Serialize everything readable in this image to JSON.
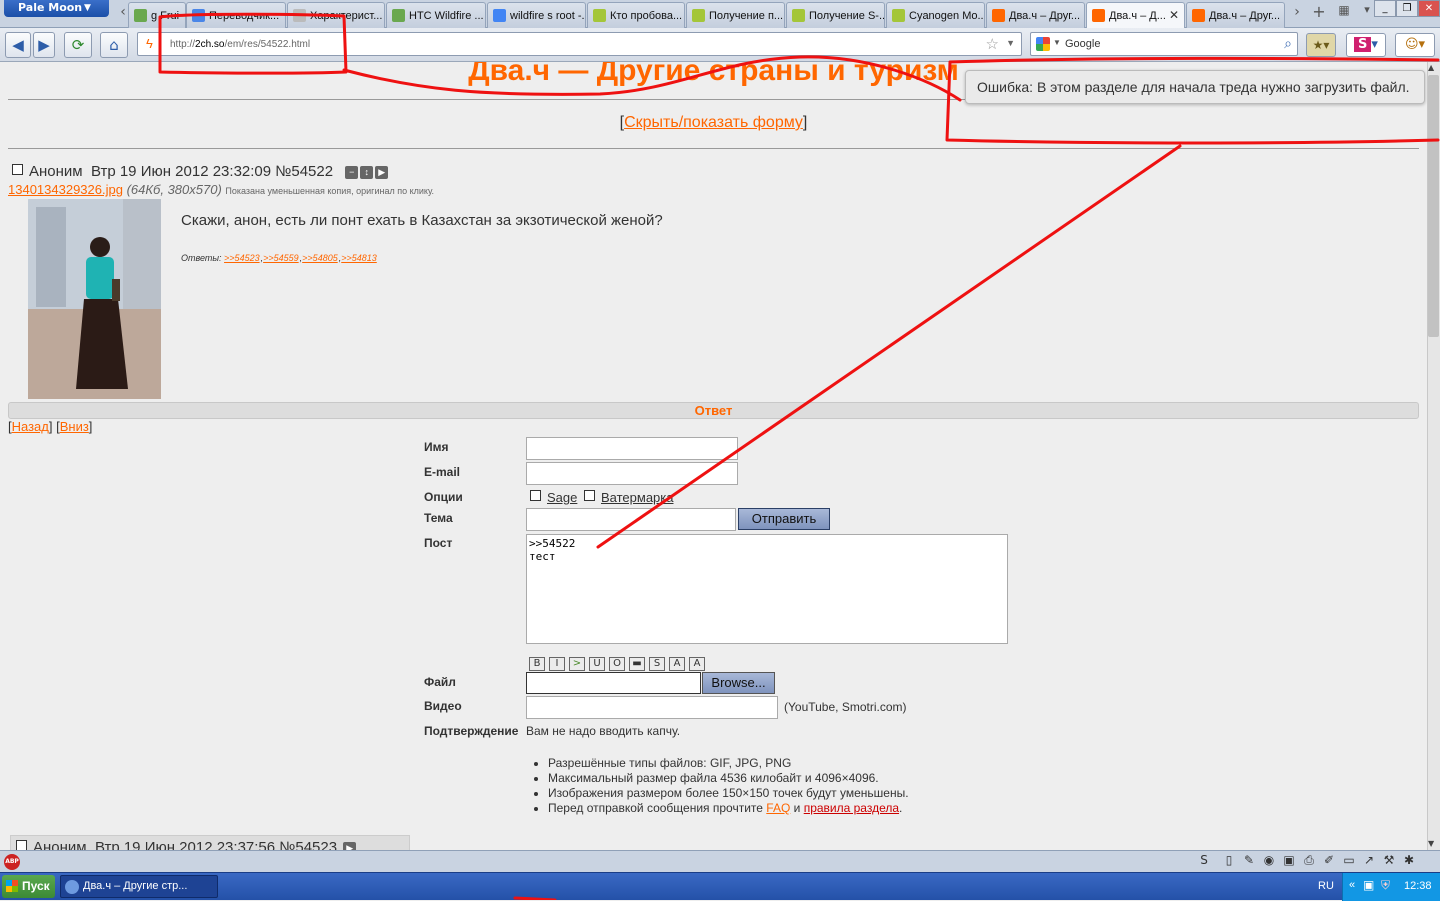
{
  "browser": {
    "app_button": "Pale Moon",
    "tabs": [
      {
        "label": "g Frui",
        "icon": "tab-icon",
        "color": "#6aa84f"
      },
      {
        "label": "Переводчик...",
        "icon": "translator-icon",
        "color": "#4a86e8"
      },
      {
        "label": "Характерист...",
        "icon": "page-icon",
        "color": "#bbbbbb"
      },
      {
        "label": "HTC Wildfire ...",
        "icon": "htc-icon",
        "color": "#6aa84f"
      },
      {
        "label": "wildfire s root -...",
        "icon": "google-icon",
        "color": "#4285f4"
      },
      {
        "label": "Кто пробова...",
        "icon": "android-icon",
        "color": "#a4c639"
      },
      {
        "label": "Получение п...",
        "icon": "android-icon",
        "color": "#a4c639"
      },
      {
        "label": "Получение S-...",
        "icon": "android-icon",
        "color": "#a4c639"
      },
      {
        "label": "Cyanogen Mo...",
        "icon": "android-icon",
        "color": "#a4c639"
      },
      {
        "label": "Два.ч – Друг...",
        "icon": "2ch-icon",
        "color": "#ff6600"
      },
      {
        "label": "Два.ч – Д...",
        "icon": "2ch-icon",
        "color": "#ff6600",
        "active": true,
        "close": "✕"
      },
      {
        "label": "Два.ч – Друг...",
        "icon": "2ch-icon",
        "color": "#ff6600"
      }
    ],
    "url_prefix": "http://",
    "url_host": "2ch.so",
    "url_path": "/em/res/54522.html",
    "search_engine": "Google"
  },
  "page": {
    "board_title": "Два.ч — Другие страны и туризм",
    "error_tooltip": "Ошибка: В этом разделе для начала треда нужно загрузить файл.",
    "toggle_open": "[",
    "toggle_form": "Скрыть/показать форму",
    "toggle_close": "]",
    "op": {
      "author": "Аноним",
      "date": "Втр 19 Июн 2012 23:32:09",
      "number": "№54522",
      "file_name": "1340134329326.jpg",
      "file_meta": "(64Кб, 380x570)",
      "file_note": "Показана уменьшенная копия, оригинал по клику.",
      "text": "Скажи, анон, есть ли понт ехать в Казахстан за экзотической женой?",
      "replies_label": "Ответы:",
      "replies": [
        ">>54523",
        ">>54559",
        ">>54805",
        ">>54813"
      ]
    },
    "reply_header": "Ответ",
    "nav_back": "Назад",
    "nav_down": "Вниз",
    "form": {
      "name_label": "Имя",
      "email_label": "E-mail",
      "options_label": "Опции",
      "sage": "Sage",
      "watermark": "Ватермарка",
      "subject_label": "Тема",
      "submit": "Отправить",
      "post_label": "Пост",
      "post_value": ">>54522\nтест",
      "format_buttons": [
        "B",
        "I",
        ">",
        "U",
        "O",
        "▬",
        "S",
        "A",
        "A"
      ],
      "file_label": "Файл",
      "browse": "Browse...",
      "video_label": "Видео",
      "video_hint": "(YouTube, Smotri.com)",
      "captcha_label": "Подтверждение",
      "captcha_text": "Вам не надо вводить капчу."
    },
    "rules": {
      "r1": "Разрешённые типы файлов: GIF, JPG, PNG",
      "r2": "Максимальный размер файла 4536 килобайт и 4096×4096.",
      "r3": "Изображения размером более 150×150 точек будут уменьшены.",
      "r4_pre": "Перед отправкой сообщения прочтите",
      "r4_faq": "FAQ",
      "r4_and": "и",
      "r4_rules": "правила раздела",
      "r4_end": "."
    },
    "next_post": {
      "author": "Аноним",
      "date": "Втр 19 Июн 2012 23:37:56",
      "number": "№54523"
    }
  },
  "taskbar": {
    "start": "Пуск",
    "window": "Два.ч – Другие стр...",
    "lang": "RU",
    "time": "12:38"
  },
  "colors": {
    "accent": "#ff6600",
    "annotation": "#ee1111"
  }
}
